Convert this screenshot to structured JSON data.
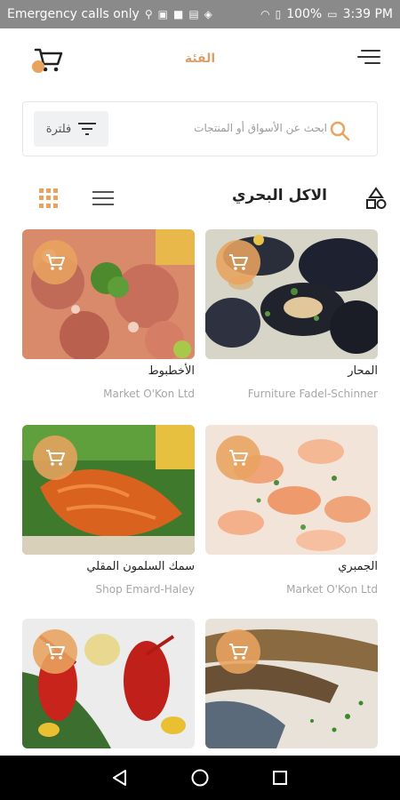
{
  "status_bar": {
    "carrier_text": "Emergency calls only",
    "battery": "100%",
    "time": "3:39 PM"
  },
  "header": {
    "title": "الفئة",
    "cart_icon": "cart-icon",
    "menu_icon": "hamburger-menu-icon"
  },
  "search": {
    "placeholder": "ابحث عن الأسواق أو المنتجات",
    "filter_label": "فلترة",
    "search_icon": "search-icon",
    "filter_icon": "filter-icon"
  },
  "section": {
    "title": "الاكل البحري",
    "grid_view_icon": "grid-view-icon",
    "list_view_icon": "list-view-icon",
    "category_icon": "shapes-icon"
  },
  "products": [
    {
      "name": "المحار",
      "market": "Furniture Fadel-Schinner"
    },
    {
      "name": "الأخطبوط",
      "market": "Market O'Kon Ltd"
    },
    {
      "name": "الجمبري",
      "market": "Market O'Kon Ltd"
    },
    {
      "name": "سمك السلمون المقلي",
      "market": "Shop Emard-Haley"
    },
    {
      "name": "",
      "market": ""
    },
    {
      "name": "",
      "market": ""
    }
  ],
  "colors": {
    "accent": "#e8a35f",
    "title": "#d9a06a",
    "status_bar": "#8a8a8a",
    "nav_bar": "#000000"
  },
  "nav": {
    "back_icon": "back-triangle-icon",
    "home_icon": "home-circle-icon",
    "recents_icon": "recents-square-icon"
  }
}
